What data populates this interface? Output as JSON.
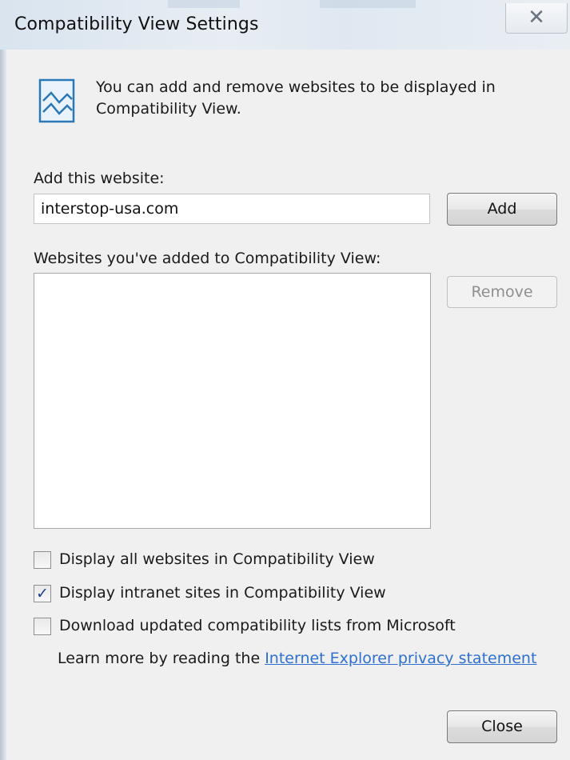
{
  "window": {
    "title": "Compatibility View Settings",
    "close_glyph": "✕"
  },
  "info": {
    "icon": "compatibility-view-icon",
    "text": "You can add and remove websites to be displayed in Compatibility View."
  },
  "add_section": {
    "label": "Add this website:",
    "value": "interstop-usa.com",
    "add_button": "Add"
  },
  "list_section": {
    "label": "Websites you've added to Compatibility View:",
    "items": [],
    "remove_button": "Remove"
  },
  "options": [
    {
      "label": "Display all websites in Compatibility View",
      "checked": false
    },
    {
      "label": "Display intranet sites in Compatibility View",
      "checked": true
    },
    {
      "label": "Download updated compatibility lists from Microsoft",
      "checked": false
    }
  ],
  "learn_more": {
    "prefix": "Learn more by reading the",
    "link_text": "Internet Explorer privacy statement"
  },
  "footer": {
    "close_button": "Close"
  },
  "colors": {
    "link": "#2e6fd1",
    "checkmark": "#1c3f8a",
    "dialog_bg": "#f0f0f0"
  }
}
